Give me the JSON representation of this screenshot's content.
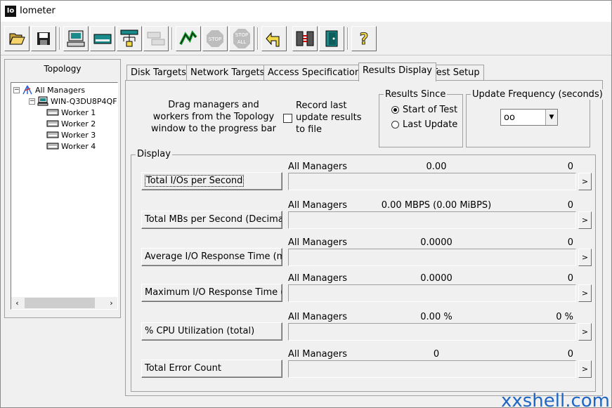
{
  "window": {
    "title": "Iometer",
    "icon_text": "Io"
  },
  "toolbar": {
    "buttons": [
      {
        "name": "open-icon"
      },
      {
        "name": "save-icon"
      },
      {
        "name": "start-new-manager-icon"
      },
      {
        "name": "start-new-disk-worker-icon"
      },
      {
        "name": "start-new-network-worker-icon"
      },
      {
        "name": "duplicate-worker-icon"
      },
      {
        "name": "start-tests-icon"
      },
      {
        "name": "stop-icon",
        "text": "STOP"
      },
      {
        "name": "stop-all-icon",
        "text": "STOP ALL"
      },
      {
        "name": "reset-workers-icon"
      },
      {
        "name": "disconnect-icon"
      },
      {
        "name": "exit-icon"
      },
      {
        "name": "help-icon",
        "text": "?"
      }
    ]
  },
  "topology": {
    "title": "Topology",
    "root": "All Managers",
    "manager": "WIN-Q3DU8P4QF",
    "workers": [
      "Worker 1",
      "Worker 2",
      "Worker 3",
      "Worker 4"
    ]
  },
  "tabs": [
    {
      "label": "Disk Targets"
    },
    {
      "label": "Network Targets"
    },
    {
      "label": "Access Specifications"
    },
    {
      "label": "Results Display",
      "active": true
    },
    {
      "label": "Test Setup"
    }
  ],
  "results": {
    "drag_text": "Drag managers and workers from the Topology window to the progress bar of your choice.",
    "record_label": "Record last update results to file",
    "results_since": {
      "title": "Results Since",
      "options": [
        "Start of Test",
        "Last Update"
      ],
      "selected": "Start of Test"
    },
    "update_frequency": {
      "title": "Update Frequency (seconds)",
      "value": "oo"
    },
    "display_title": "Display",
    "metrics": [
      {
        "label": "Total I/Os per Second",
        "manager": "All Managers",
        "value": "0.00",
        "max": "0",
        "fill": 0
      },
      {
        "label": "Total MBs per Second (Decimal)",
        "manager": "All Managers",
        "value": "0.00 MBPS (0.00 MiBPS)",
        "max": "0",
        "fill": 0
      },
      {
        "label": "Average I/O Response Time (ms)",
        "manager": "All Managers",
        "value": "0.0000",
        "max": "0",
        "fill": 0
      },
      {
        "label": "Maximum I/O Response Time (ms)",
        "manager": "All Managers",
        "value": "0.0000",
        "max": "0",
        "fill": 0
      },
      {
        "label": "% CPU Utilization (total)",
        "manager": "All Managers",
        "value": "0.00 %",
        "max": "0 %",
        "fill": 0
      },
      {
        "label": "Total Error Count",
        "manager": "All Managers",
        "value": "0",
        "max": "0",
        "fill": 0
      }
    ],
    "expand_arrow": ">"
  },
  "watermark": "xxshell.com"
}
